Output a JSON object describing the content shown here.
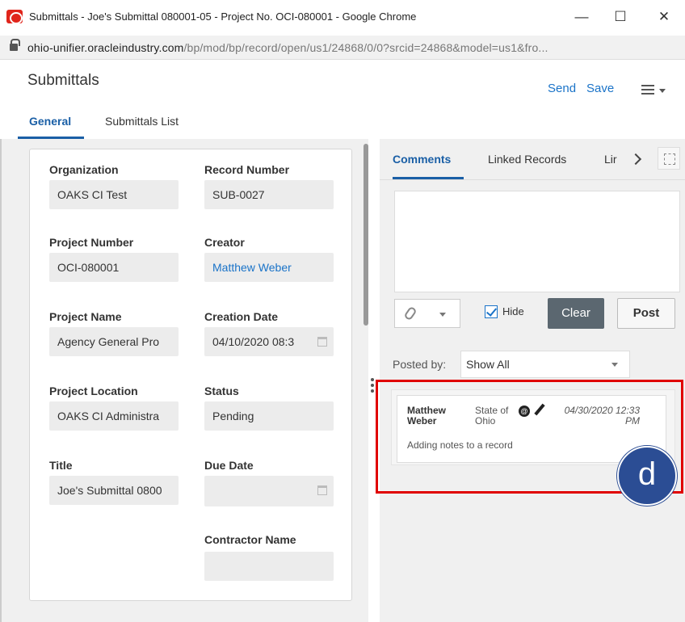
{
  "window": {
    "title": "Submittals - Joe's Submittal 080001-05 - Project No. OCI-080001 - Google Chrome",
    "minimize": "—",
    "maximize": "☐",
    "close": "✕"
  },
  "address": {
    "host": "ohio-unifier.oracleindustry.com",
    "path": "/bp/mod/bp/record/open/us1/24868/0/0?srcid=24868&model=us1&fro..."
  },
  "header": {
    "title": "Submittals",
    "send_label": "Send",
    "save_label": "Save"
  },
  "tabs": [
    {
      "label": "General"
    },
    {
      "label": "Submittals List"
    }
  ],
  "form": {
    "organization": {
      "label": "Organization",
      "value": "OAKS CI Test"
    },
    "record_number": {
      "label": "Record Number",
      "value": "SUB-0027"
    },
    "project_number": {
      "label": "Project Number",
      "value": "OCI-080001"
    },
    "creator": {
      "label": "Creator",
      "value": "Matthew Weber"
    },
    "project_name": {
      "label": "Project Name",
      "value": "Agency General Pro"
    },
    "creation_date": {
      "label": "Creation Date",
      "value": "04/10/2020 08:3"
    },
    "project_location": {
      "label": "Project Location",
      "value": "OAKS CI Administra"
    },
    "status": {
      "label": "Status",
      "value": "Pending"
    },
    "title": {
      "label": "Title",
      "value": "Joe's Submittal 0800"
    },
    "due_date": {
      "label": "Due Date",
      "value": ""
    },
    "contractor_name": {
      "label": "Contractor Name",
      "value": ""
    }
  },
  "right_panel": {
    "tabs": [
      {
        "label": "Comments"
      },
      {
        "label": "Linked Records"
      },
      {
        "label": "Lir"
      }
    ],
    "hide_label": "Hide",
    "hide_checked": true,
    "clear_label": "Clear",
    "post_label": "Post",
    "posted_by_label": "Posted by:",
    "posted_by_value": "Show All",
    "comments": [
      {
        "author": "Matthew Weber",
        "org": "State of Ohio",
        "date": "04/30/2020 12:33 PM",
        "text": "Adding notes to a record"
      }
    ]
  },
  "annotation": {
    "badge_letter": "d",
    "highlight_color": "#e00000",
    "badge_color": "#2b4d94"
  }
}
